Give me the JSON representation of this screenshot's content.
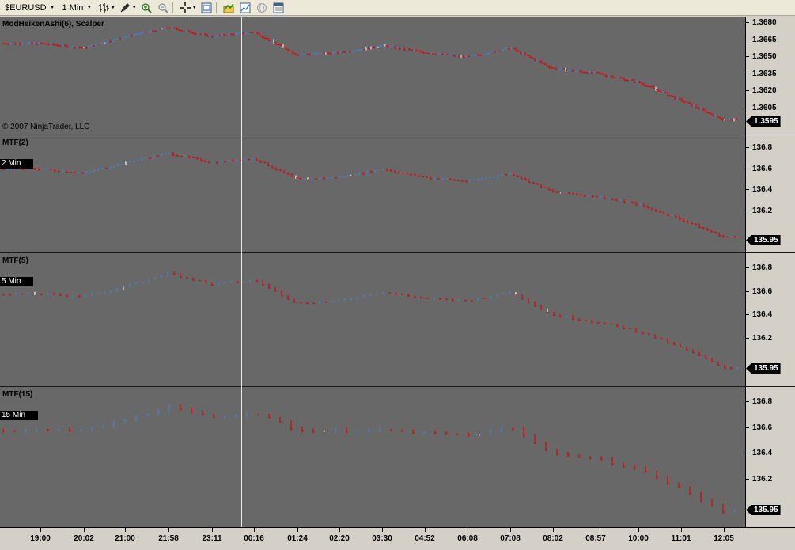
{
  "toolbar": {
    "instrument": "$EURUSD",
    "interval": "1 Min",
    "buttons": [
      {
        "name": "bar-type-icon"
      },
      {
        "name": "drawing-pen-icon"
      },
      {
        "name": "zoom-in-icon"
      },
      {
        "name": "zoom-out-icon"
      },
      {
        "name": "crosshair-icon"
      },
      {
        "name": "properties-icon"
      },
      {
        "name": "strategies-icon"
      },
      {
        "name": "indicators-icon"
      },
      {
        "name": "globe-icon"
      },
      {
        "name": "data-box-icon"
      }
    ]
  },
  "colors": {
    "background": "#686868",
    "up_bar": "#4a7fc0",
    "down_bar": "#e00000",
    "doji_bar": "#ffffff",
    "axis_bg": "#d4d0c8"
  },
  "panels": [
    {
      "title": "ModHeikenAshi(6), Scalper",
      "badge": "",
      "copyright": "© 2007 NinjaTrader, LLC",
      "yticks": [
        "1.3680",
        "1.3665",
        "1.3650",
        "1.3635",
        "1.3620",
        "1.3605"
      ],
      "last_price": "1.3595",
      "bar_step": 3
    },
    {
      "title": "MTF(2)",
      "badge": "2 Min",
      "copyright": "",
      "yticks": [
        "136.8",
        "136.6",
        "136.4",
        "136.2"
      ],
      "last_price": "135.95",
      "bar_step": 5
    },
    {
      "title": "MTF(5)",
      "badge": "5 Min",
      "copyright": "",
      "yticks": [
        "136.8",
        "136.6",
        "136.4",
        "136.2"
      ],
      "last_price": "135.95",
      "bar_step": 8
    },
    {
      "title": "MTF(15)",
      "badge": "15 Min",
      "copyright": "",
      "yticks": [
        "136.8",
        "136.6",
        "136.4",
        "136.2"
      ],
      "last_price": "135.95",
      "bar_step": 14
    }
  ],
  "xaxis": {
    "labels": [
      "19:00",
      "20:02",
      "21:00",
      "21:58",
      "23:11",
      "00:16",
      "01:24",
      "02:20",
      "03:30",
      "04:52",
      "06:08",
      "07:08",
      "08:02",
      "08:57",
      "10:00",
      "11:01",
      "12:05"
    ]
  },
  "chart_data": {
    "type": "bar",
    "title": "",
    "x": [
      "19:00",
      "20:02",
      "21:00",
      "21:58",
      "23:11",
      "00:16",
      "01:24",
      "02:20",
      "03:30",
      "04:52",
      "06:08",
      "07:08",
      "08:02",
      "08:57",
      "10:00",
      "11:01",
      "12:05"
    ],
    "series": [
      {
        "name": "ModHeikenAshi(6), Scalper",
        "values": [
          1.3662,
          1.3658,
          1.3668,
          1.3676,
          1.3668,
          1.3672,
          1.3652,
          1.3654,
          1.366,
          1.3654,
          1.365,
          1.3658,
          1.364,
          1.3636,
          1.3628,
          1.3612,
          1.3595
        ]
      },
      {
        "name": "MTF(2)",
        "values": [
          136.6,
          136.56,
          136.66,
          136.75,
          136.66,
          136.7,
          136.5,
          136.52,
          136.6,
          136.52,
          136.48,
          136.56,
          136.38,
          136.34,
          136.26,
          136.12,
          135.95
        ]
      },
      {
        "name": "MTF(5)",
        "values": [
          136.58,
          136.56,
          136.64,
          136.76,
          136.66,
          136.7,
          136.5,
          136.52,
          136.6,
          136.54,
          136.52,
          136.6,
          136.4,
          136.34,
          136.26,
          136.12,
          135.95
        ]
      },
      {
        "name": "MTF(15)",
        "values": [
          136.58,
          136.58,
          136.66,
          136.76,
          136.68,
          136.72,
          136.58,
          136.58,
          136.58,
          136.56,
          136.54,
          136.6,
          136.4,
          136.36,
          136.28,
          136.12,
          135.95
        ]
      }
    ],
    "ylim_panel1": [
      1.359,
      1.3688
    ],
    "ylim_mtf": [
      135.9,
      136.88
    ]
  }
}
